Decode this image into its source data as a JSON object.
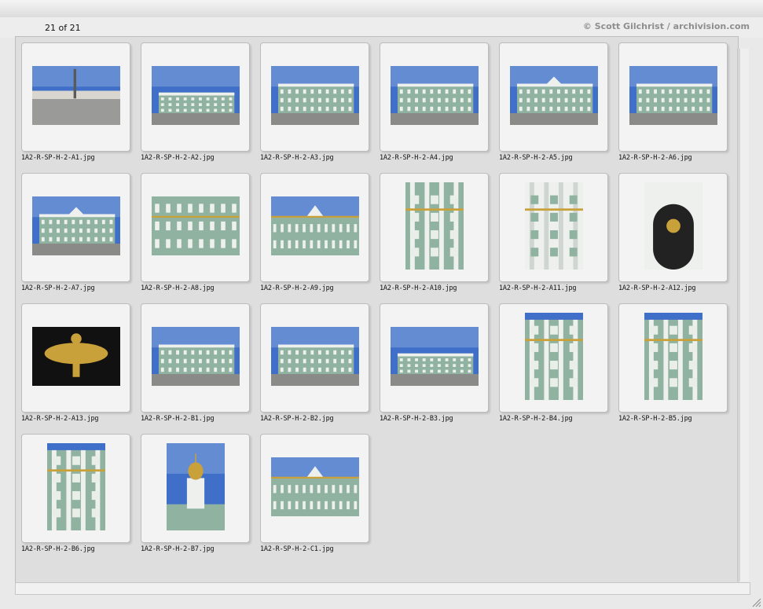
{
  "header": {
    "count": "21 of 21",
    "credit": "© Scott Gilchrist / archivision.com"
  },
  "grid": {
    "items": [
      {
        "filename": "1A2-R-SP-H-2-A1.jpg",
        "orientation": "landscape",
        "scene": "square"
      },
      {
        "filename": "1A2-R-SP-H-2-A2.jpg",
        "orientation": "landscape",
        "scene": "palace-far"
      },
      {
        "filename": "1A2-R-SP-H-2-A3.jpg",
        "orientation": "landscape",
        "scene": "palace-angle"
      },
      {
        "filename": "1A2-R-SP-H-2-A4.jpg",
        "orientation": "landscape",
        "scene": "palace"
      },
      {
        "filename": "1A2-R-SP-H-2-A5.jpg",
        "orientation": "landscape",
        "scene": "palace-front"
      },
      {
        "filename": "1A2-R-SP-H-2-A6.jpg",
        "orientation": "landscape",
        "scene": "palace"
      },
      {
        "filename": "1A2-R-SP-H-2-A7.jpg",
        "orientation": "landscape",
        "scene": "palace-front"
      },
      {
        "filename": "1A2-R-SP-H-2-A8.jpg",
        "orientation": "landscape",
        "scene": "facade"
      },
      {
        "filename": "1A2-R-SP-H-2-A9.jpg",
        "orientation": "landscape",
        "scene": "facade-sky"
      },
      {
        "filename": "1A2-R-SP-H-2-A10.jpg",
        "orientation": "portrait",
        "scene": "facade-close"
      },
      {
        "filename": "1A2-R-SP-H-2-A11.jpg",
        "orientation": "portrait",
        "scene": "columns"
      },
      {
        "filename": "1A2-R-SP-H-2-A12.jpg",
        "orientation": "portrait",
        "scene": "gate"
      },
      {
        "filename": "1A2-R-SP-H-2-A13.jpg",
        "orientation": "landscape",
        "scene": "eagle"
      },
      {
        "filename": "1A2-R-SP-H-2-B1.jpg",
        "orientation": "landscape",
        "scene": "palace-angle"
      },
      {
        "filename": "1A2-R-SP-H-2-B2.jpg",
        "orientation": "landscape",
        "scene": "palace-angle"
      },
      {
        "filename": "1A2-R-SP-H-2-B3.jpg",
        "orientation": "landscape",
        "scene": "palace-far"
      },
      {
        "filename": "1A2-R-SP-H-2-B4.jpg",
        "orientation": "portrait",
        "scene": "tower"
      },
      {
        "filename": "1A2-R-SP-H-2-B5.jpg",
        "orientation": "portrait",
        "scene": "tower"
      },
      {
        "filename": "1A2-R-SP-H-2-B6.jpg",
        "orientation": "portrait",
        "scene": "corner"
      },
      {
        "filename": "1A2-R-SP-H-2-B7.jpg",
        "orientation": "portrait",
        "scene": "dome"
      },
      {
        "filename": "1A2-R-SP-H-2-C1.jpg",
        "orientation": "landscape",
        "scene": "facade-sky"
      }
    ]
  },
  "colors": {
    "sky": "#3f6fc9",
    "sky_light": "#a9c4e6",
    "facade": "#8fb3a0",
    "white": "#eef0ee",
    "gold": "#c9a13a",
    "ground": "#8a8a88"
  }
}
